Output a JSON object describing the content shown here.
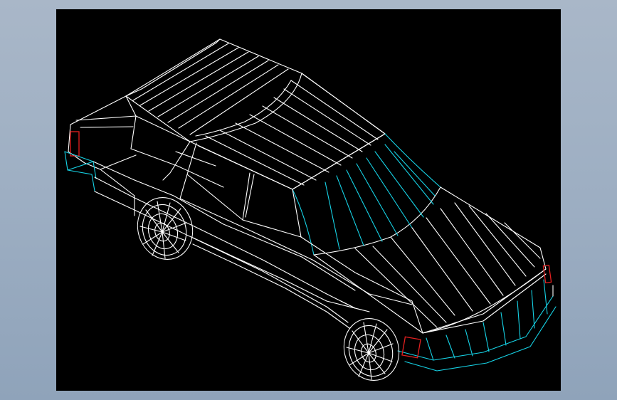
{
  "viewer": {
    "background_color": "#000000",
    "frame_color": "#9eafc3",
    "line_colors": {
      "body_edges": "#ffffff",
      "highlight_edges": "#16d3e6",
      "light_edges": "#e32020"
    }
  },
  "model": {
    "subject": "station-wagon-wireframe",
    "view": "isometric"
  }
}
